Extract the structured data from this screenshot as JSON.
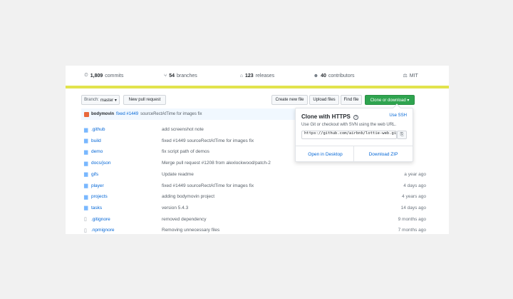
{
  "summary": {
    "commits_count": "1,809",
    "commits_label": "commits",
    "branches_count": "54",
    "branches_label": "branches",
    "releases_count": "123",
    "releases_label": "releases",
    "contributors_count": "40",
    "contributors_label": "contributors",
    "license": "MIT"
  },
  "toolbar": {
    "branch_prefix": "Branch:",
    "branch_name": "master ▾",
    "new_pull_request": "New pull request",
    "create_new_file": "Create new file",
    "upload_files": "Upload files",
    "find_file": "Find file",
    "clone_download": "Clone or download ▾"
  },
  "latest_commit": {
    "user": "bodymovin",
    "prefix": "fixed",
    "issue": "#1449",
    "message": "sourceRectAtTime for images fix"
  },
  "files": [
    {
      "name": ".github",
      "message": "add screenshot note",
      "age": "",
      "type": "folder"
    },
    {
      "name": "build",
      "message": "fixed #1449 sourceRectAtTime for images fix",
      "age": "",
      "type": "folder"
    },
    {
      "name": "demo",
      "message": "fix script path of demos",
      "age": "",
      "type": "folder"
    },
    {
      "name": "docs/json",
      "message": "Merge pull request #1208 from alexlockwood/patch-2",
      "age": "",
      "type": "folder"
    },
    {
      "name": "gifs",
      "message": "Update readme",
      "age": "a year ago",
      "type": "folder"
    },
    {
      "name": "player",
      "message": "fixed #1449 sourceRectAtTime for images fix",
      "age": "4 days ago",
      "type": "folder"
    },
    {
      "name": "projects",
      "message": "adding bodymovin project",
      "age": "4 years ago",
      "type": "folder"
    },
    {
      "name": "tasks",
      "message": "version 5.4.3",
      "age": "14 days ago",
      "type": "folder"
    },
    {
      "name": ".gitignore",
      "message": "removed dependency",
      "age": "9 months ago",
      "type": "file"
    },
    {
      "name": ".npmignore",
      "message": "Removing unnecessary files",
      "age": "7 months ago",
      "type": "file"
    }
  ],
  "clone_dropdown": {
    "title": "Clone with HTTPS",
    "help": "?",
    "use_ssh": "Use SSH",
    "description": "Use Git or checkout with SVN using the web URL.",
    "url": "https://github.com/airbnb/lottie-web.git",
    "open_desktop": "Open in Desktop",
    "download_zip": "Download ZIP"
  },
  "icons": {
    "commits": "history-icon",
    "branches": "branch-icon",
    "releases": "tag-icon",
    "contributors": "people-icon",
    "license": "law-icon",
    "folder": "folder-icon",
    "file": "file-icon",
    "copy": "clipboard-icon"
  },
  "colors": {
    "language_bar": "#e2e34c",
    "primary_button": "#2ea44f",
    "link": "#0366d6",
    "commit_bar": "#f1f8ff"
  }
}
